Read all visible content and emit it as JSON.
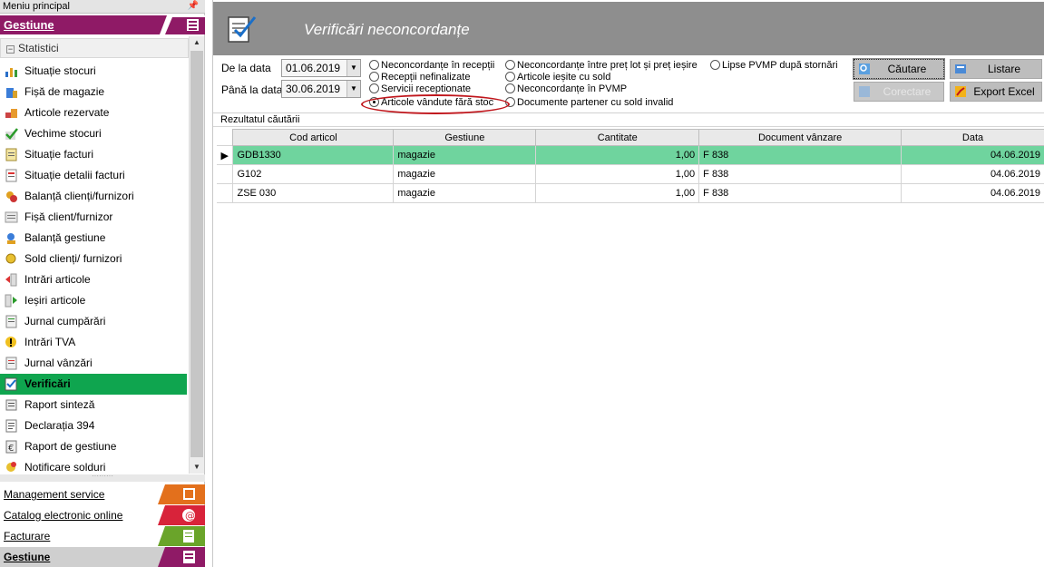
{
  "sidebar": {
    "title": "Meniu principal",
    "pin": "ᵩ",
    "module_header": "Gestiune",
    "section": "Statistici",
    "items": [
      {
        "label": "Situație stocuri",
        "icon": "chart-icon"
      },
      {
        "label": "Fișă de magazie",
        "icon": "building-icon"
      },
      {
        "label": "Articole rezervate",
        "icon": "boxes-icon"
      },
      {
        "label": "Vechime stocuri",
        "icon": "check-icon"
      },
      {
        "label": "Situație facturi",
        "icon": "invoice-icon"
      },
      {
        "label": "Situație detalii facturi",
        "icon": "invoice-detail-icon"
      },
      {
        "label": "Balanță clienți/furnizori",
        "icon": "balance-icon"
      },
      {
        "label": "Fișă client/furnizor",
        "icon": "client-card-icon"
      },
      {
        "label": "Balanță gestiune",
        "icon": "balance-stock-icon"
      },
      {
        "label": "Sold clienți/ furnizori",
        "icon": "coins-icon"
      },
      {
        "label": "Intrări articole",
        "icon": "arrow-in-icon"
      },
      {
        "label": "Ieșiri articole",
        "icon": "arrow-out-icon"
      },
      {
        "label": "Jurnal cumpărări",
        "icon": "journal-buy-icon"
      },
      {
        "label": "Intrări TVA",
        "icon": "warning-coin-icon"
      },
      {
        "label": "Jurnal vânzări",
        "icon": "journal-sell-icon"
      },
      {
        "label": "Verificări",
        "icon": "verify-icon"
      },
      {
        "label": "Raport sinteză",
        "icon": "report-icon"
      },
      {
        "label": "Declarația 394",
        "icon": "declaration-icon"
      },
      {
        "label": "Raport de gestiune",
        "icon": "euro-report-icon"
      },
      {
        "label": "Notificare solduri",
        "icon": "notify-icon"
      }
    ],
    "active_item": "Verificări",
    "modules": [
      {
        "label": "Management service",
        "color": "#e3701c"
      },
      {
        "label": "Catalog electronic online",
        "color": "#d8233a"
      },
      {
        "label": "Facturare",
        "color": "#6aa42a"
      },
      {
        "label": "Gestiune",
        "color": "#8f1a66"
      }
    ]
  },
  "header": {
    "title": "Verificări neconcordanțe"
  },
  "filters": {
    "from_label": "De la data",
    "from_value": "01.06.2019",
    "to_label": "Până la data",
    "to_value": "30.06.2019",
    "options": [
      {
        "label": "Neconcordanțe în recepții",
        "selected": false
      },
      {
        "label": "Recepții nefinalizate",
        "selected": false
      },
      {
        "label": "Servicii receptionate",
        "selected": false
      },
      {
        "label": "Articole vândute fără stoc",
        "selected": true
      },
      {
        "label": "Neconcordanțe între preț lot și preț ieșire",
        "selected": false
      },
      {
        "label": "Articole ieșite cu sold",
        "selected": false
      },
      {
        "label": "Neconcordanțe în PVMP",
        "selected": false
      },
      {
        "label": "Documente partener cu sold invalid",
        "selected": false
      },
      {
        "label": "Lipse PVMP după stornări",
        "selected": false
      }
    ]
  },
  "buttons": {
    "search": "Căutare",
    "list": "Listare",
    "correct": "Corectare",
    "export": "Export Excel"
  },
  "results": {
    "label": "Rezultatul căutării",
    "columns": [
      "Cod articol",
      "Gestiune",
      "Cantitate",
      "Document vânzare",
      "Data"
    ],
    "rows": [
      [
        "GDB1330",
        "magazie",
        "1,00",
        "F 838",
        "04.06.2019"
      ],
      [
        "G102",
        "magazie",
        "1,00",
        "F 838",
        "04.06.2019"
      ],
      [
        "ZSE 030",
        "magazie",
        "1,00",
        "F 838",
        "04.06.2019"
      ]
    ]
  },
  "colors": {
    "gestiune": "#8f1a66",
    "active_item": "#0fa54f",
    "selected_row": "#6fd49e",
    "banner": "#8e8e8e",
    "highlight_oval": "#c0161c"
  }
}
